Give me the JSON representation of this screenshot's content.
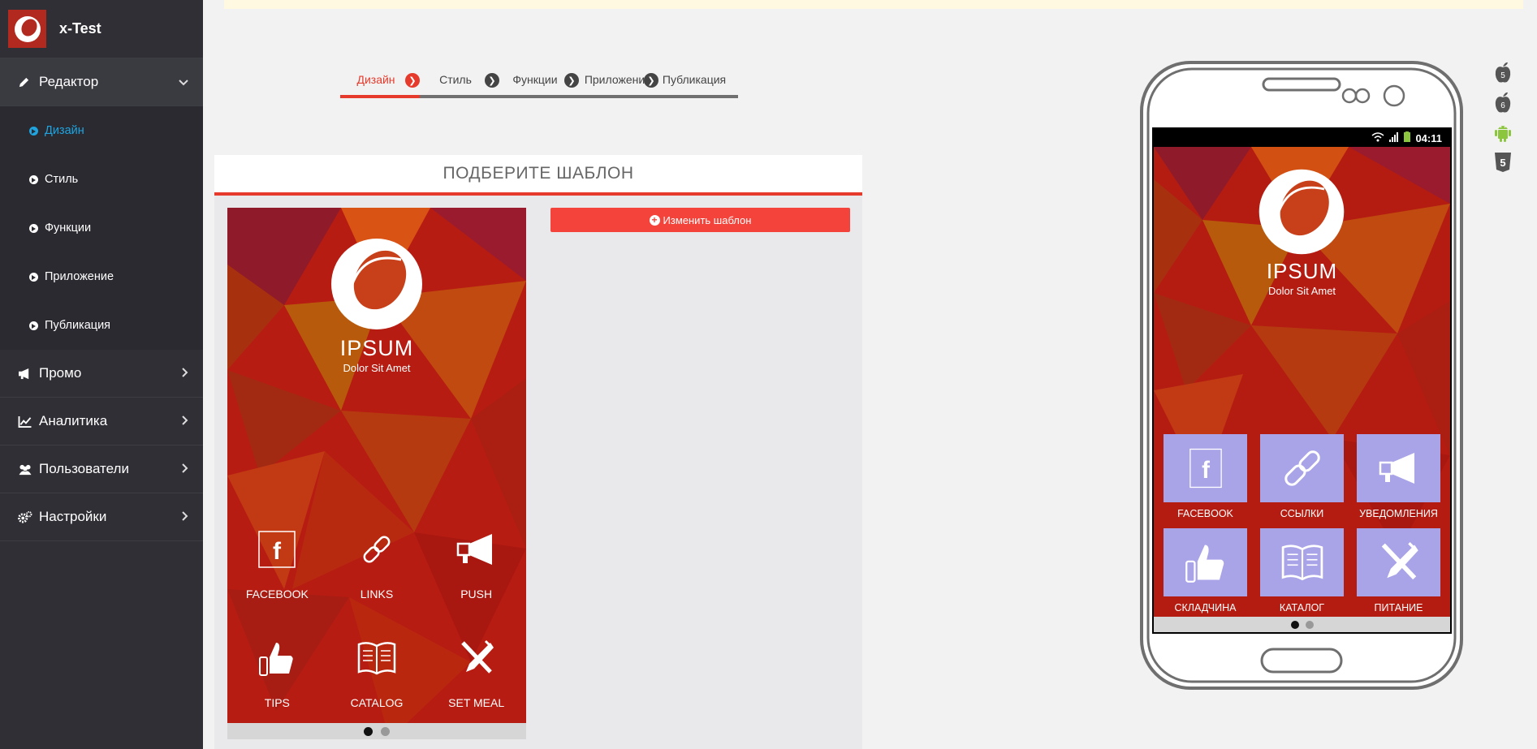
{
  "brand": {
    "title": "x-Test"
  },
  "sidebar": {
    "sections": [
      {
        "label": "Редактор",
        "icon": "pencil-icon",
        "open": true
      },
      {
        "label": "Промо",
        "icon": "megaphone-icon"
      },
      {
        "label": "Аналитика",
        "icon": "chart-line-icon"
      },
      {
        "label": "Пользователи",
        "icon": "users-icon"
      },
      {
        "label": "Настройки",
        "icon": "gears-icon"
      }
    ],
    "editor_items": [
      {
        "label": "Дизайн",
        "active": true
      },
      {
        "label": "Стиль"
      },
      {
        "label": "Функции"
      },
      {
        "label": "Приложение"
      },
      {
        "label": "Публикация"
      }
    ]
  },
  "steps": [
    "Дизайн",
    "Стиль",
    "Функции",
    "Приложени",
    "Публикация"
  ],
  "panel": {
    "title": "ПОДБЕРИТЕ ШАБЛОН",
    "change_button": "Изменить шаблон"
  },
  "preview": {
    "app_name": "IPSUM",
    "app_tagline": "Dolor Sit Amet",
    "items": [
      "FACEBOOK",
      "LINKS",
      "PUSH",
      "TIPS",
      "CATALOG",
      "SET MEAL"
    ]
  },
  "phone": {
    "time": "04:11",
    "app_name": "IPSUM",
    "app_tagline": "Dolor Sit Amet",
    "tiles": [
      "FACEBOOK",
      "ССЫЛКИ",
      "УВЕДОМЛЕНИЯ",
      "СКЛАДЧИНА",
      "КАТАЛОГ",
      "ПИТАНИЕ"
    ]
  },
  "platforms": [
    {
      "icon": "ios5-icon",
      "label": "5"
    },
    {
      "icon": "ios6-icon",
      "label": "6"
    },
    {
      "icon": "android-icon"
    },
    {
      "icon": "html5-icon",
      "label": "5"
    }
  ],
  "colors": {
    "accent": "#e63b2c",
    "sidebar": "#2f2f35",
    "active_link": "#1fa4e0",
    "tile": "#a9a3e8",
    "android": "#8cc63f"
  }
}
